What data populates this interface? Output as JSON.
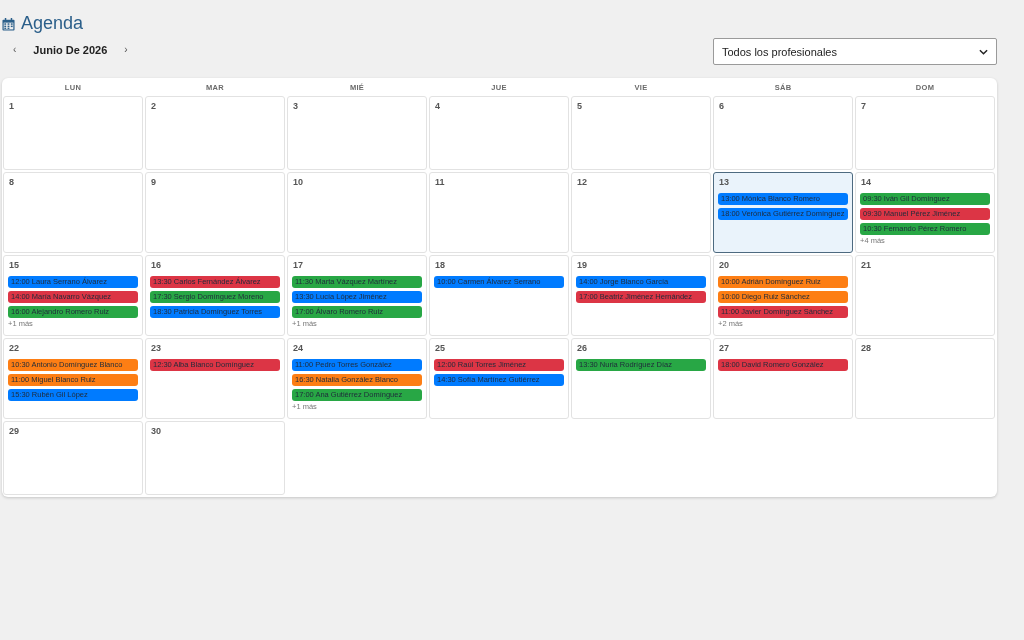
{
  "header": {
    "title": "Agenda"
  },
  "navigation": {
    "previous": "‹",
    "month": "Junio De 2026",
    "next": "›"
  },
  "professional_filter": {
    "value": "Todos los profesionales"
  },
  "calendar": {
    "weekdays": [
      "LUN",
      "MAR",
      "MIÉ",
      "JUE",
      "VIE",
      "SÁB",
      "DOM"
    ],
    "days": [
      {
        "number": "1",
        "selected": false
      },
      {
        "number": "2",
        "selected": false
      },
      {
        "number": "3",
        "selected": false
      },
      {
        "number": "4",
        "selected": false
      },
      {
        "number": "5",
        "selected": false
      },
      {
        "number": "6",
        "selected": false
      },
      {
        "number": "7",
        "selected": false
      },
      {
        "number": "8",
        "selected": false
      },
      {
        "number": "9",
        "selected": false
      },
      {
        "number": "10",
        "selected": false
      },
      {
        "number": "11",
        "selected": false
      },
      {
        "number": "12",
        "selected": false
      },
      {
        "number": "13",
        "selected": true,
        "events": [
          {
            "label": "13:00 Mónica Blanco Romero",
            "color": "#007bff"
          },
          {
            "label": "18:00 Verónica Gutiérrez Domínguez",
            "color": "#007bff"
          }
        ]
      },
      {
        "number": "14",
        "selected": false,
        "events": [
          {
            "label": "09:30 Iván Gil Domínguez",
            "color": "#28a745"
          },
          {
            "label": "09:30 Manuel Pérez Jiménez",
            "color": "#dc3545"
          },
          {
            "label": "10:30 Fernando Pérez Romero",
            "color": "#28a745"
          }
        ],
        "more": "+4 más"
      },
      {
        "number": "15",
        "selected": false,
        "events": [
          {
            "label": "12:00 Laura Serrano Álvarez",
            "color": "#007bff"
          },
          {
            "label": "14:00 María Navarro Vázquez",
            "color": "#dc3545"
          },
          {
            "label": "16:00 Alejandro Romero Ruiz",
            "color": "#28a745"
          }
        ],
        "more": "+1 más"
      },
      {
        "number": "16",
        "selected": false,
        "events": [
          {
            "label": "13:30 Carlos Fernández Álvarez",
            "color": "#dc3545"
          },
          {
            "label": "17:30 Sergio Domínguez Moreno",
            "color": "#28a745"
          },
          {
            "label": "18:30 Patricia Domínguez Torres",
            "color": "#007bff"
          }
        ]
      },
      {
        "number": "17",
        "selected": false,
        "events": [
          {
            "label": "11:30 Marta Vázquez Martínez",
            "color": "#28a745"
          },
          {
            "label": "13:30 Lucía López Jiménez",
            "color": "#007bff"
          },
          {
            "label": "17:00 Álvaro Romero Ruiz",
            "color": "#28a745"
          }
        ],
        "more": "+1 más"
      },
      {
        "number": "18",
        "selected": false,
        "events": [
          {
            "label": "10:00 Carmen Álvarez Serrano",
            "color": "#007bff"
          }
        ]
      },
      {
        "number": "19",
        "selected": false,
        "events": [
          {
            "label": "14:00 Jorge Blanco García",
            "color": "#007bff"
          },
          {
            "label": "17:00 Beatriz Jiménez Hernández",
            "color": "#dc3545"
          }
        ]
      },
      {
        "number": "20",
        "selected": false,
        "events": [
          {
            "label": "10:00 Adrián Domínguez Ruiz",
            "color": "#fd7e14"
          },
          {
            "label": "10:00 Diego Ruiz Sánchez",
            "color": "#fd7e14"
          },
          {
            "label": "11:00 Javier Domínguez Sánchez",
            "color": "#dc3545"
          }
        ],
        "more": "+2 más"
      },
      {
        "number": "21",
        "selected": false
      },
      {
        "number": "22",
        "selected": false,
        "events": [
          {
            "label": "10:30 Antonio Domínguez Blanco",
            "color": "#fd7e14"
          },
          {
            "label": "11:00 Miguel Blanco Ruiz",
            "color": "#fd7e14"
          },
          {
            "label": "15:30 Rubén Gil López",
            "color": "#007bff"
          }
        ]
      },
      {
        "number": "23",
        "selected": false,
        "events": [
          {
            "label": "12:30 Alba Blanco Domínguez",
            "color": "#dc3545"
          }
        ]
      },
      {
        "number": "24",
        "selected": false,
        "events": [
          {
            "label": "11:00 Pedro Torres González",
            "color": "#007bff"
          },
          {
            "label": "16:30 Natalia González Blanco",
            "color": "#fd7e14"
          },
          {
            "label": "17:00 Ana Gutiérrez Domínguez",
            "color": "#28a745"
          }
        ],
        "more": "+1 más"
      },
      {
        "number": "25",
        "selected": false,
        "events": [
          {
            "label": "12:00 Raúl Torres Jiménez",
            "color": "#dc3545"
          },
          {
            "label": "14:30 Sofía Martínez Gutiérrez",
            "color": "#007bff"
          }
        ]
      },
      {
        "number": "26",
        "selected": false,
        "events": [
          {
            "label": "13:30 Nuria Rodríguez Díaz",
            "color": "#28a745"
          }
        ]
      },
      {
        "number": "27",
        "selected": false,
        "events": [
          {
            "label": "18:00 David Romero González",
            "color": "#dc3545"
          }
        ]
      },
      {
        "number": "28",
        "selected": false
      },
      {
        "number": "29",
        "selected": false
      },
      {
        "number": "30",
        "selected": false
      }
    ]
  }
}
